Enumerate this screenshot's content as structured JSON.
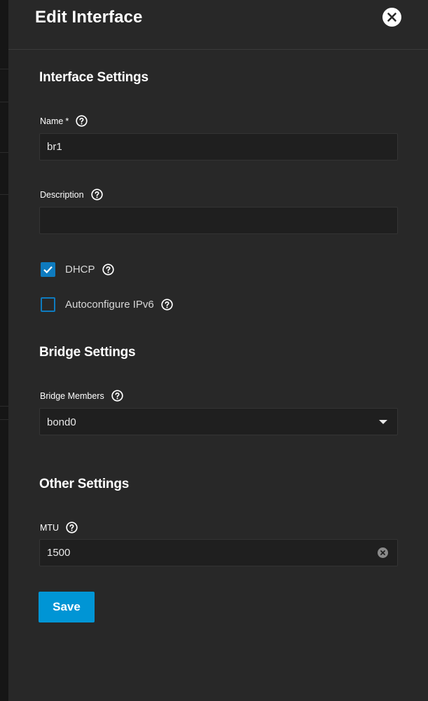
{
  "header": {
    "title": "Edit Interface",
    "close_icon": "close-icon"
  },
  "interface_settings": {
    "title": "Interface Settings",
    "name": {
      "label": "Name",
      "required_mark": "*",
      "value": "br1"
    },
    "description": {
      "label": "Description",
      "value": ""
    },
    "dhcp": {
      "label": "DHCP",
      "checked": true
    },
    "autoconfigure_ipv6": {
      "label": "Autoconfigure IPv6",
      "checked": false
    }
  },
  "bridge_settings": {
    "title": "Bridge Settings",
    "bridge_members": {
      "label": "Bridge Members",
      "value": "bond0"
    }
  },
  "other_settings": {
    "title": "Other Settings",
    "mtu": {
      "label": "MTU",
      "value": "1500"
    }
  },
  "actions": {
    "save_label": "Save"
  },
  "colors": {
    "accent": "#0095d5",
    "checkbox": "#0e7bbf",
    "panel_bg": "#282828",
    "input_bg": "#1f1f1f"
  }
}
